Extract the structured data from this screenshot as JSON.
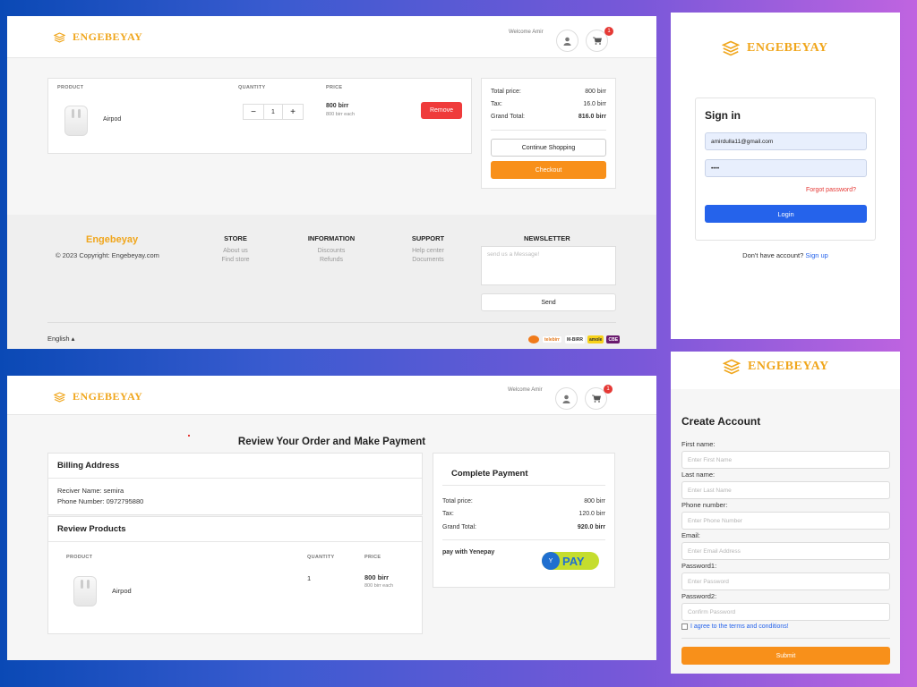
{
  "brand": {
    "name": "ENGEBEYAY",
    "color": "#f0a61c"
  },
  "header": {
    "welcome": "Welcome Amir",
    "cart_count": "1"
  },
  "cart": {
    "columns": [
      "PRODUCT",
      "QUANTITY",
      "PRICE"
    ],
    "item": {
      "name": "Airpod",
      "quantity": "1",
      "price": "800 birr",
      "price_each": "800 birr each",
      "remove_label": "Remove"
    },
    "qty_minus": "−",
    "qty_plus": "+",
    "summary": {
      "total_label": "Total price:",
      "total_value": "800 birr",
      "tax_label": "Tax:",
      "tax_value": "16.0 birr",
      "grand_label": "Grand Total:",
      "grand_value": "816.0 birr"
    },
    "continue_label": "Continue Shopping",
    "checkout_label": "Checkout"
  },
  "footer": {
    "brand": "Engebeyay",
    "copyright": "© 2023 Copyright: Engebeyay.com",
    "store": {
      "title": "STORE",
      "links": [
        "About us",
        "Find store"
      ]
    },
    "information": {
      "title": "INFORMATION",
      "links": [
        "Discounts",
        "Refunds"
      ]
    },
    "support": {
      "title": "SUPPORT",
      "links": [
        "Help center",
        "Documents"
      ]
    },
    "newsletter": {
      "title": "NEWSLETTER",
      "placeholder": "send us a Message!",
      "send_label": "Send"
    },
    "language": "English ▴",
    "payment_logos": [
      "telebirr",
      "M-BIRR",
      "amole",
      "CBE"
    ]
  },
  "review": {
    "title": "Review Your Order and Make Payment",
    "billing": {
      "title": "Billing Address",
      "receiver": "Reciver Name: semira",
      "phone": "Phone Number: 0972795880"
    },
    "products": {
      "title": "Review Products",
      "columns": [
        "PRODUCT",
        "QUANTITY",
        "PRICE"
      ],
      "item_name": "Airpod",
      "quantity": "1",
      "price": "800 birr",
      "price_each": "800 birr each"
    },
    "payment": {
      "title": "Complete Payment",
      "total_label": "Total price:",
      "total_value": "800 birr",
      "tax_label": "Tax:",
      "tax_value": "120.0 birr",
      "grand_label": "Grand Total:",
      "grand_value": "920.0 birr",
      "pay_with": "pay with Yenepay",
      "pay_logo_text": "PAY"
    }
  },
  "signin": {
    "title": "Sign in",
    "email_value": "amirdulla11@gmail.com",
    "password_value": "••••",
    "forgot_label": "Forgot password?",
    "login_label": "Login",
    "no_account": "Don't have account?",
    "signup_label": "Sign up"
  },
  "create": {
    "title": "Create Account",
    "fields": [
      {
        "label": "First name:",
        "placeholder": "Enter First Name"
      },
      {
        "label": "Last name:",
        "placeholder": "Enter Last Name"
      },
      {
        "label": "Phone number:",
        "placeholder": "Enter Phone Number"
      },
      {
        "label": "Email:",
        "placeholder": "Enter Email Address"
      },
      {
        "label": "Password1:",
        "placeholder": "Enter Password"
      },
      {
        "label": "Password2:",
        "placeholder": "Confirm Password"
      }
    ],
    "terms_label": "I agree to the terms and conditions!",
    "submit_label": "Submit"
  },
  "colors": {
    "orange": "#f8901a",
    "red": "#ef3b3b",
    "blue": "#2563eb"
  }
}
